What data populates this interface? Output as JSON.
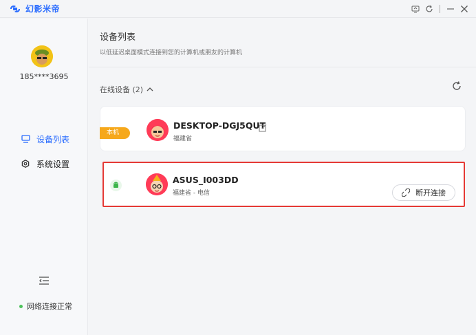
{
  "app": {
    "name": "幻影米帝",
    "brand_color": "#2a6cff",
    "window_controls": [
      "screen-icon",
      "refresh-icon",
      "minimize-icon",
      "close-icon"
    ]
  },
  "sidebar": {
    "account": "185****3695",
    "nav": [
      {
        "label": "设备列表",
        "icon": "monitor-icon",
        "active": true
      },
      {
        "label": "系统设置",
        "icon": "gear-icon",
        "active": false
      }
    ],
    "network_status": "网络连接正常"
  },
  "main": {
    "title": "设备列表",
    "subtitle": "以低延迟桌面模式连接到您的计算机或朋友的计算机",
    "online_label": "在线设备 (2)",
    "devices": [
      {
        "tag": "本机",
        "name": "DESKTOP-DGJ5QUT",
        "location": "福建省"
      },
      {
        "name": "ASUS_I003DD",
        "location": "福建省 - 电信",
        "action": "断开连接"
      }
    ]
  },
  "colors": {
    "accent": "#2a6cff",
    "local_tag": "#f6a81b",
    "highlight_border": "#e53935",
    "online_dot": "#4cc25a"
  }
}
